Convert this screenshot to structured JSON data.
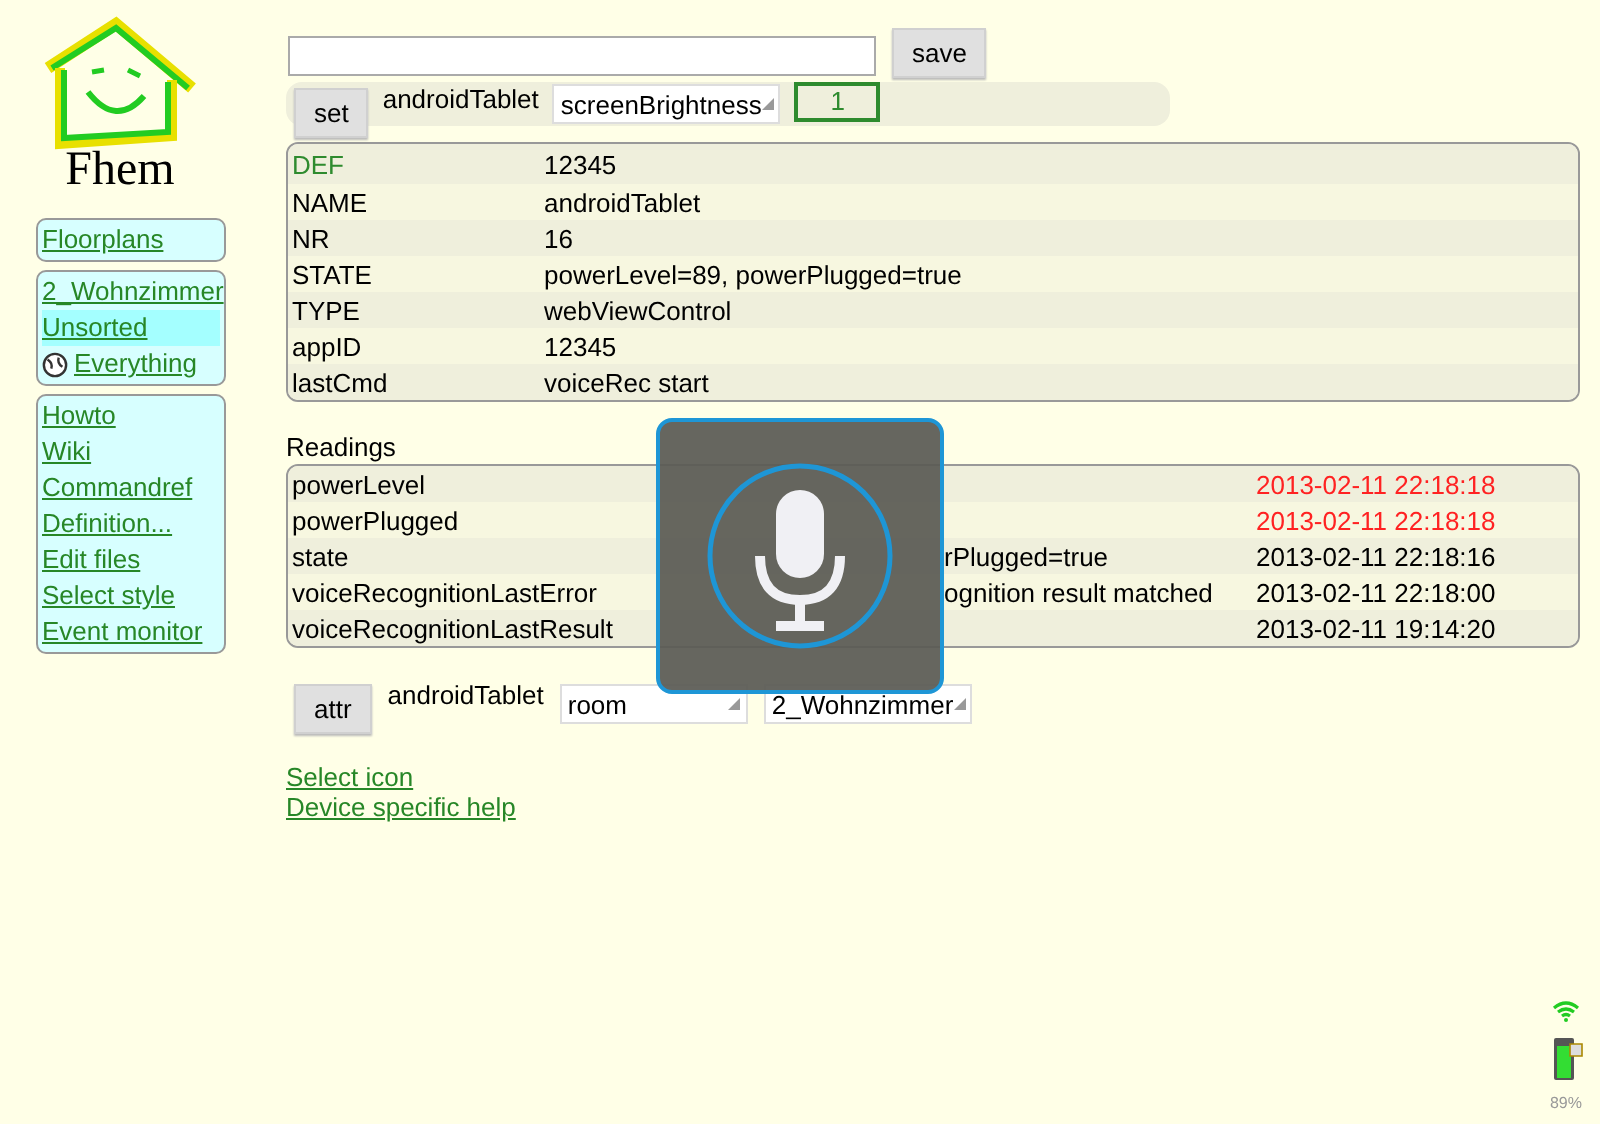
{
  "logo": {
    "text": "Fhem"
  },
  "sidebar": {
    "groups": [
      {
        "items": [
          {
            "label": "Floorplans",
            "kind": "link",
            "selected": false
          }
        ]
      },
      {
        "items": [
          {
            "label": "2_Wohnzimmer",
            "kind": "link",
            "selected": false
          },
          {
            "label": "Unsorted",
            "kind": "link",
            "selected": true
          },
          {
            "label": " Everything",
            "kind": "icon-link",
            "selected": false
          }
        ]
      },
      {
        "items": [
          {
            "label": "Howto",
            "kind": "link",
            "selected": false
          },
          {
            "label": "Wiki",
            "kind": "link",
            "selected": false
          },
          {
            "label": "Commandref",
            "kind": "link",
            "selected": false
          },
          {
            "label": "Definition...",
            "kind": "link",
            "selected": false
          },
          {
            "label": "Edit files",
            "kind": "link",
            "selected": false
          },
          {
            "label": "Select style",
            "kind": "link",
            "selected": false
          },
          {
            "label": "Event monitor",
            "kind": "link",
            "selected": false
          }
        ]
      }
    ]
  },
  "command": {
    "button": "save"
  },
  "set": {
    "button": "set",
    "device": "androidTablet",
    "select": "screenBrightness",
    "value": "1"
  },
  "internals": {
    "rows": [
      {
        "name": "DEF",
        "value": "12345",
        "kind": "definition"
      },
      {
        "name": "NAME",
        "value": "androidTablet",
        "kind": "plain"
      },
      {
        "name": "NR",
        "value": "16",
        "kind": "plain"
      },
      {
        "name": "STATE",
        "value": "powerLevel=89, powerPlugged=true",
        "kind": "plain"
      },
      {
        "name": "TYPE",
        "value": "webViewControl",
        "kind": "plain"
      },
      {
        "name": "appID",
        "value": "12345",
        "kind": "plain"
      },
      {
        "name": "lastCmd",
        "value": "voiceRec start",
        "kind": "plain"
      }
    ]
  },
  "readings": {
    "title": "Readings",
    "rows": [
      {
        "name": "powerLevel",
        "time": "2013-02-11 22:18:18",
        "recent": true
      },
      {
        "name": "powerPlugged",
        "time": "2013-02-11 22:18:18",
        "recent": true
      },
      {
        "name": "state",
        "value": "rPlugged=true",
        "value_cut": true,
        "time": "2013-02-11 22:18:16",
        "recent": false
      },
      {
        "name": "voiceRecognitionLastError",
        "value": "ognition result matched",
        "value_cut": true,
        "time": "2013-02-11 22:18:00",
        "recent": false
      },
      {
        "name": "voiceRecognitionLastResult",
        "time": "2013-02-11 19:14:20",
        "recent": false
      }
    ]
  },
  "attr": {
    "button": "attr",
    "device": "androidTablet",
    "select": "room",
    "value": "2_Wohnzimmer"
  },
  "links": [
    "Select icon",
    "Device specific help"
  ],
  "voice_overlay": {
    "listening": true
  },
  "status": {
    "battery": "89%"
  }
}
